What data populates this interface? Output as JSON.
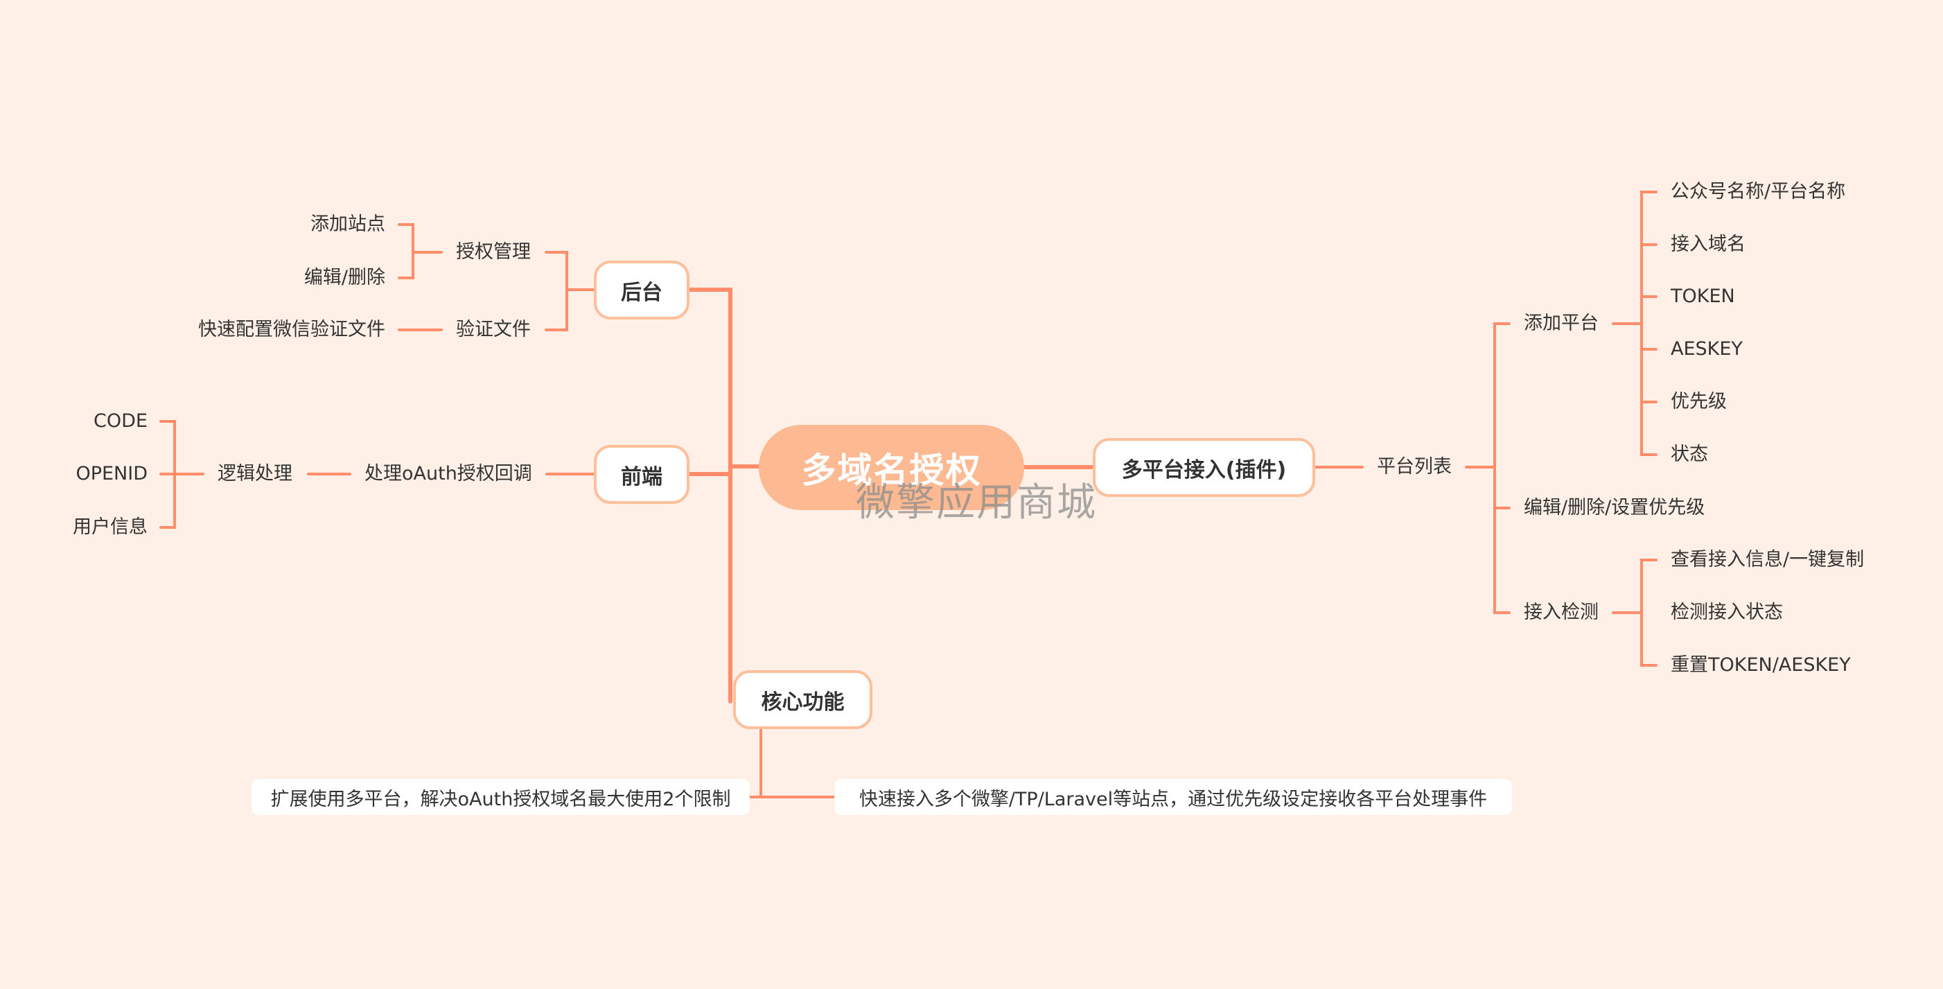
{
  "colors": {
    "background": "#FEF0E6",
    "line": "#FF8C6B",
    "central_fill": "#FDBA92",
    "node_border": "#FFBF9A",
    "text": "#333333"
  },
  "central": {
    "label": "多域名授权"
  },
  "watermark": "微擎应用商城",
  "left": {
    "houtai": {
      "label": "后台",
      "children": [
        {
          "label": "授权管理",
          "children": [
            "添加站点",
            "编辑/删除"
          ]
        },
        {
          "label": "验证文件",
          "children": [
            "快速配置微信验证文件"
          ]
        }
      ]
    },
    "qianduan": {
      "label": "前端",
      "child": "处理oAuth授权回调",
      "grandchild": "逻辑处理",
      "leaves": [
        "CODE",
        "OPENID",
        "用户信息"
      ]
    }
  },
  "core": {
    "label": "核心功能",
    "notes": [
      "扩展使用多平台，解决oAuth授权域名最大使用2个限制",
      "快速接入多个微擎/TP/Laravel等站点，通过优先级设定接收各平台处理事件"
    ]
  },
  "right": {
    "label": "多平台接入(插件)",
    "child": "平台列表",
    "items": [
      {
        "label": "添加平台",
        "children": [
          "公众号名称/平台名称",
          "接入域名",
          "TOKEN",
          "AESKEY",
          "优先级",
          "状态"
        ]
      },
      {
        "label": "编辑/删除/设置优先级",
        "children": []
      },
      {
        "label": "接入检测",
        "children": [
          "查看接入信息/一键复制",
          "检测接入状态",
          "重置TOKEN/AESKEY"
        ]
      }
    ]
  }
}
